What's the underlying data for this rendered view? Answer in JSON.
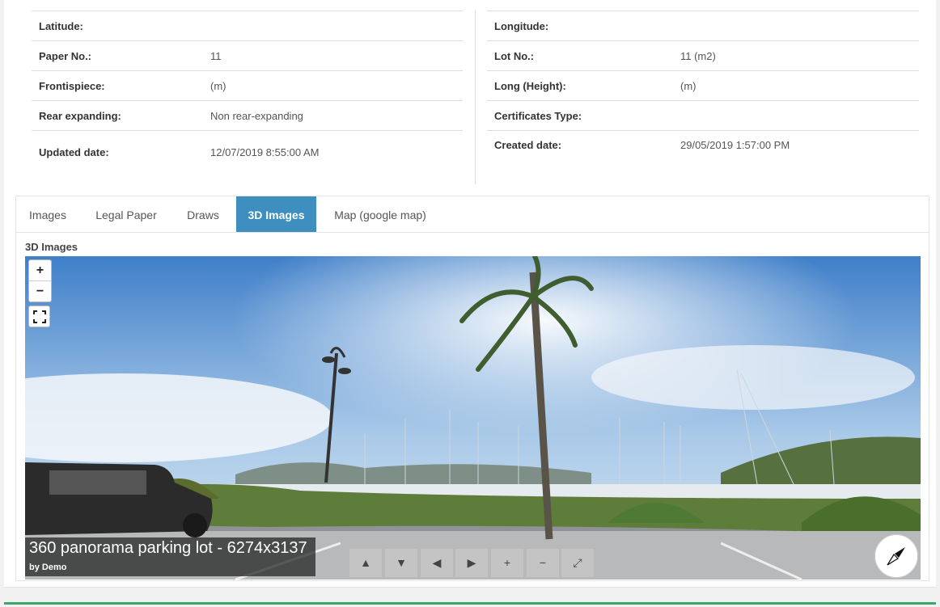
{
  "details": {
    "left": [
      {
        "label": "Latitude:",
        "value": ""
      },
      {
        "label": "Paper No.:",
        "value": "11"
      },
      {
        "label": "Frontispiece:",
        "value": "(m)"
      },
      {
        "label": "Rear expanding:",
        "value": "Non rear-expanding"
      },
      {
        "label": "Updated date:",
        "value": "12/07/2019 8:55:00 AM"
      }
    ],
    "right": [
      {
        "label": "Longitude:",
        "value": ""
      },
      {
        "label": "Lot No.:",
        "value": "11 (m2)"
      },
      {
        "label": "Long (Height):",
        "value": "(m)"
      },
      {
        "label": "Certificates Type:",
        "value": ""
      },
      {
        "label": "Created date:",
        "value": "29/05/2019 1:57:00 PM"
      }
    ]
  },
  "tabs": [
    "Images",
    "Legal Paper",
    "Draws",
    "3D Images",
    "Map (google map)"
  ],
  "active_tab": "3D Images",
  "section_title": "3D Images",
  "viewer": {
    "zoom_in": "+",
    "zoom_out": "−",
    "caption_title": "360 panorama parking lot - 6274x3137",
    "caption_by": "by Demo",
    "nav": [
      "▲",
      "▼",
      "◀",
      "▶",
      "+",
      "−",
      "⤢"
    ]
  },
  "colors": {
    "accent": "#3e8ebf",
    "bottom_bar": "#3aa76d"
  }
}
